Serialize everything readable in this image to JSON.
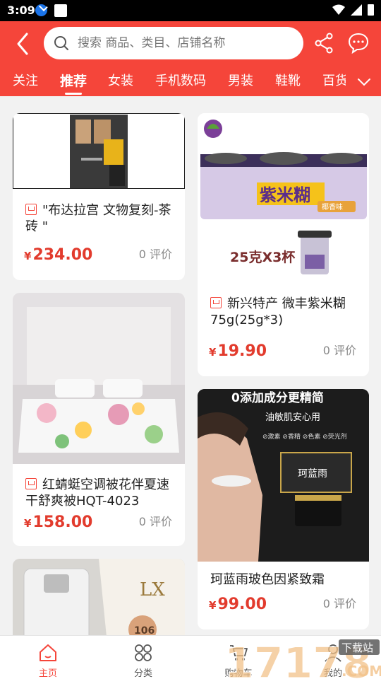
{
  "status_bar": {
    "time": "3:09"
  },
  "search": {
    "placeholder": "搜索 商品、类目、店铺名称"
  },
  "tabs": [
    {
      "label": "关注"
    },
    {
      "label": "推荐"
    },
    {
      "label": "女装"
    },
    {
      "label": "手机数码"
    },
    {
      "label": "男装"
    },
    {
      "label": "鞋靴"
    },
    {
      "label": "百货"
    }
  ],
  "products": [
    {
      "title": "\"布达拉宫 文物复刻-茶砖 \"",
      "currency": "¥",
      "price": "234.00",
      "reviews": "0 评价"
    },
    {
      "title": "新兴特产 微丰紫米糊75g(25g*3)",
      "currency": "¥",
      "price": "19.90",
      "reviews": "0 评价",
      "image_text": {
        "brand": "紫米糊",
        "portion": "25克X3杯",
        "flavor": "椰香味"
      }
    },
    {
      "title": "红蜻蜓空调被花伴夏速干舒爽被HQT-4023",
      "currency": "¥",
      "price": "158.00",
      "reviews": "0 评价"
    },
    {
      "title": "珂蓝雨玻色因紧致霜",
      "currency": "¥",
      "price": "99.00",
      "reviews": "0 评价",
      "image_text": {
        "headline": "0添加成分更精简",
        "sub": "油敏肌安心用",
        "pill": "⊘激素 ⊘香精 ⊘色素 ⊘荧光剂",
        "box_brand": "珂蓝雨"
      }
    },
    {
      "title": "",
      "image_text": {
        "logo": "LX",
        "num": "106"
      }
    }
  ],
  "bottom_nav": [
    {
      "label": "主页",
      "icon": "home-icon"
    },
    {
      "label": "分类",
      "icon": "category-icon"
    },
    {
      "label": "购物车",
      "icon": "cart-icon"
    },
    {
      "label": "我的",
      "icon": "profile-icon"
    }
  ],
  "watermark": {
    "text": "17178",
    "badge": "下载站",
    "suffix": ".COM"
  },
  "colors": {
    "accent": "#f5453a",
    "price": "#e23b2d"
  }
}
